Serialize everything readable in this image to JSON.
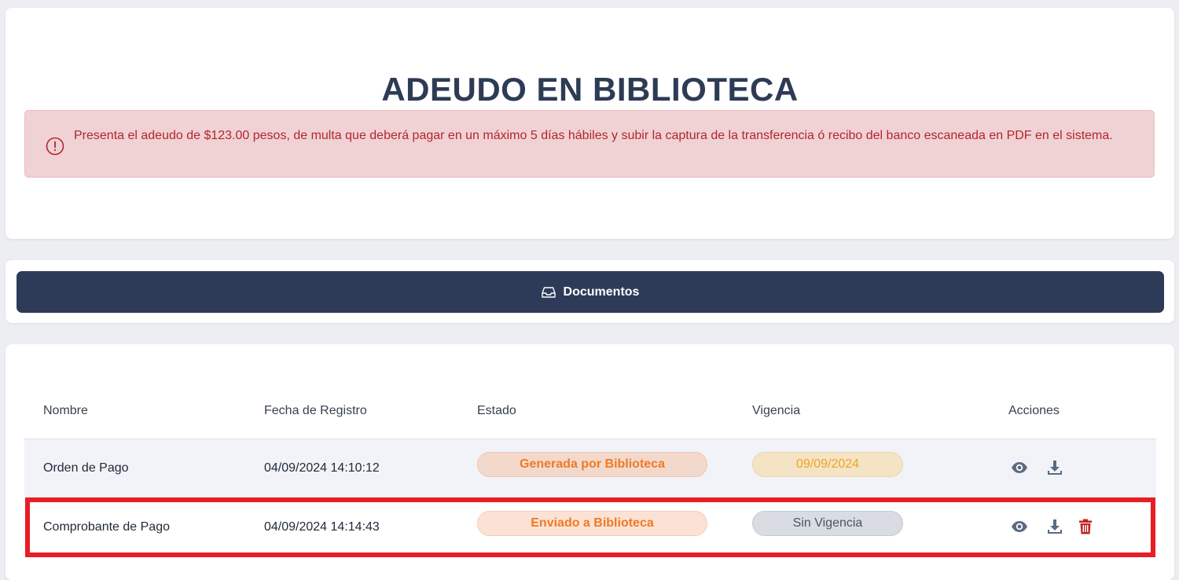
{
  "header": {
    "title": "ADEUDO EN BIBLIOTECA"
  },
  "alert": {
    "icon": "exclamation-circle-icon",
    "message": "Presenta el adeudo de $123.00 pesos, de multa que deberá pagar en un máximo 5 días hábiles y subir la captura de la transferencia ó recibo del banco escaneada en PDF en el sistema.",
    "color": "#b3262d"
  },
  "documents_button": {
    "icon": "inbox-icon",
    "label": "Documentos"
  },
  "table": {
    "columns": [
      "Nombre",
      "Fecha de Registro",
      "Estado",
      "Vigencia",
      "Acciones"
    ],
    "rows": [
      {
        "nombre": "Orden de Pago",
        "fecha": "04/09/2024 14:10:12",
        "estado": "Generada por Biblioteca",
        "vigencia": "09/09/2024",
        "actions": [
          "eye-icon",
          "download-icon"
        ]
      },
      {
        "nombre": "Comprobante de Pago",
        "fecha": "04/09/2024 14:14:43",
        "estado": "Enviado a Biblioteca",
        "vigencia": "Sin Vigencia",
        "actions": [
          "eye-icon",
          "download-icon",
          "trash-icon"
        ]
      }
    ]
  },
  "colors": {
    "primary": "#2e3b58",
    "alert_bg": "#f0d2d4",
    "status_orange": "#f07a23",
    "vigencia_yellow": "#f2a31e",
    "delete_red": "#c0211f",
    "highlight_red": "#ea1c24"
  }
}
